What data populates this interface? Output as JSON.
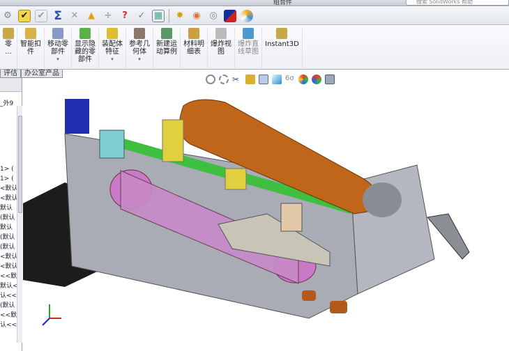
{
  "window": {
    "title": "组合件",
    "search_placeholder": "搜索 SolidWorks 帮助"
  },
  "quick_toolbar": {
    "icons": [
      "tolerance-icon",
      "check-icon",
      "check-disabled-icon",
      "mass-properties-sigma-icon",
      "interference-icon",
      "warning-icon",
      "clearance-icon",
      "hole-align-icon",
      "measure-icon",
      "bom-table-icon",
      "exploded-icon",
      "render-icon",
      "check-circle-icon",
      "color-icon",
      "appearance-icon"
    ]
  },
  "ribbon": {
    "items": [
      {
        "label": "零\n..."
      },
      {
        "label": "智能扣\n件"
      },
      {
        "label": "移动零\n部件",
        "dropdown": true
      },
      {
        "label": "显示隐\n藏的零\n部件"
      },
      {
        "label": "装配体\n特征",
        "dropdown": true
      },
      {
        "label": "参考几\n何体",
        "dropdown": true
      },
      {
        "label": "新建运\n动算例"
      },
      {
        "label": "材料明\n细表"
      },
      {
        "label": "爆炸视\n图"
      },
      {
        "label": "爆炸直\n线草图",
        "disabled": true
      },
      {
        "label": "Instant3D"
      }
    ]
  },
  "tabs": [
    "评估",
    "办公室产品"
  ],
  "tree": {
    "items": [
      "_外9",
      "1> (",
      "1> (",
      "<默认",
      "<默认",
      "默认",
      "(默认",
      "默认",
      "(默认",
      "(默认",
      "<默认",
      "<默认",
      "<<默",
      "默认<",
      "认<<",
      "(默认",
      "<<默",
      "认<<"
    ]
  },
  "colors": {
    "motor": "#c0661a",
    "belt": "#c87ac8",
    "frame": "#a7a9b3",
    "bracket": "#e0d040",
    "block": "#7fcfd0",
    "green": "#3fbf3f",
    "stepper": "#1a1a1a"
  }
}
